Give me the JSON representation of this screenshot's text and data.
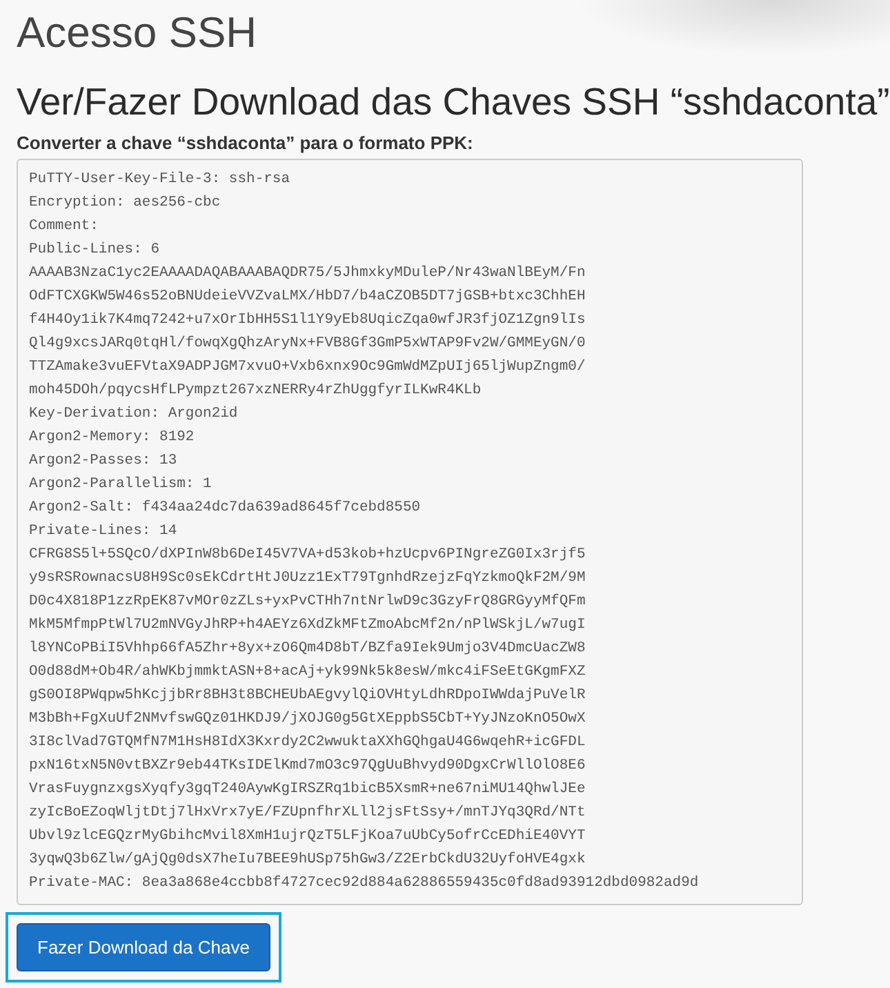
{
  "page_title": "Acesso SSH",
  "section_title": "Ver/Fazer Download das Chaves SSH “sshdaconta”",
  "key_label": "Converter a chave “sshdaconta” para o formato PPK:",
  "key_lines": [
    "PuTTY-User-Key-File-3: ssh-rsa",
    "Encryption: aes256-cbc",
    "Comment:",
    "Public-Lines: 6",
    "AAAAB3NzaC1yc2EAAAADAQABAAABAQDR75/5JhmxkyMDuleP/Nr43waNlBEyM/Fn",
    "OdFTCXGKW5W46s52oBNUdeieVVZvaLMX/HbD7/b4aCZOB5DT7jGSB+btxc3ChhEH",
    "f4H4Oy1ik7K4mq7242+u7xOrIbHH5S1l1Y9yEb8UqicZqa0wfJR3fjOZ1Zgn9lIs",
    "Ql4g9xcsJARq0tqHl/fowqXgQhzAryNx+FVB8Gf3GmP5xWTAP9Fv2W/GMMEyGN/0",
    "TTZAmake3vuEFVtaX9ADPJGM7xvuO+Vxb6xnx9Oc9GmWdMZpUIj65ljWupZngm0/",
    "moh45DOh/pqycsHfLPympzt267xzNERRy4rZhUggfyrILKwR4KLb",
    "Key-Derivation: Argon2id",
    "Argon2-Memory: 8192",
    "Argon2-Passes: 13",
    "Argon2-Parallelism: 1",
    "Argon2-Salt: f434aa24dc7da639ad8645f7cebd8550",
    "Private-Lines: 14",
    "CFRG8S5l+5SQcO/dXPInW8b6DeI45V7VA+d53kob+hzUcpv6PINgreZG0Ix3rjf5",
    "y9sRSRownacsU8H9Sc0sEkCdrtHtJ0Uzz1ExT79TgnhdRzejzFqYzkmoQkF2M/9M",
    "D0c4X818P1zzRpEK87vMOr0zZLs+yxPvCTHh7ntNrlwD9c3GzyFrQ8GRGyyMfQFm",
    "MkM5MfmpPtWl7U2mNVGyJhRP+h4AEYz6XdZkMFtZmoAbcMf2n/nPlWSkjL/w7ugI",
    "l8YNCoPBiI5Vhhp66fA5Zhr+8yx+zO6Qm4D8bT/BZfa9Iek9Umjo3V4DmcUacZW8",
    "O0d88dM+Ob4R/ahWKbjmmktASN+8+acAj+yk99Nk5k8esW/mkc4iFSeEtGKgmFXZ",
    "gS0OI8PWqpw5hKcjjbRr8BH3t8BCHEUbAEgvylQiOVHtyLdhRDpoIWWdajPuVelR",
    "M3bBh+FgXuUf2NMvfswGQz01HKDJ9/jXOJG0g5GtXEppbS5CbT+YyJNzoKnO5OwX",
    "3I8clVad7GTQMfN7M1HsH8IdX3Kxrdy2C2wwuktaXXhGQhgaU4G6wqehR+icGFDL",
    "pxN16txN5N0vtBXZr9eb44TKsIDElKmd7mO3c97QgUuBhvyd90DgxCrWllOlO8E6",
    "VrasFuygnzxgsXyqfy3gqT240AywKgIRSZRq1bicB5XsmR+ne67niMU14QhwlJEe",
    "zyIcBoEZoqWljtDtj7lHxVrx7yE/FZUpnfhrXLll2jsFtSsy+/mnTJYq3QRd/NTt",
    "Ubvl9zlcEGQzrMyGbihcMvil8XmH1ujrQzT5LFjKoa7uUbCy5ofrCcEDhiE40VYT",
    "3yqwQ3b6Zlw/gAjQg0dsX7heIu7BEE9hUSp75hGw3/Z2ErbCkdU32UyfoHVE4gxk",
    "Private-MAC: 8ea3a868e4ccbb8f4727cec92d884a62886559435c0fd8ad93912dbd0982ad9d"
  ],
  "download_button": {
    "label": "Fazer Download da Chave",
    "focused": true
  }
}
